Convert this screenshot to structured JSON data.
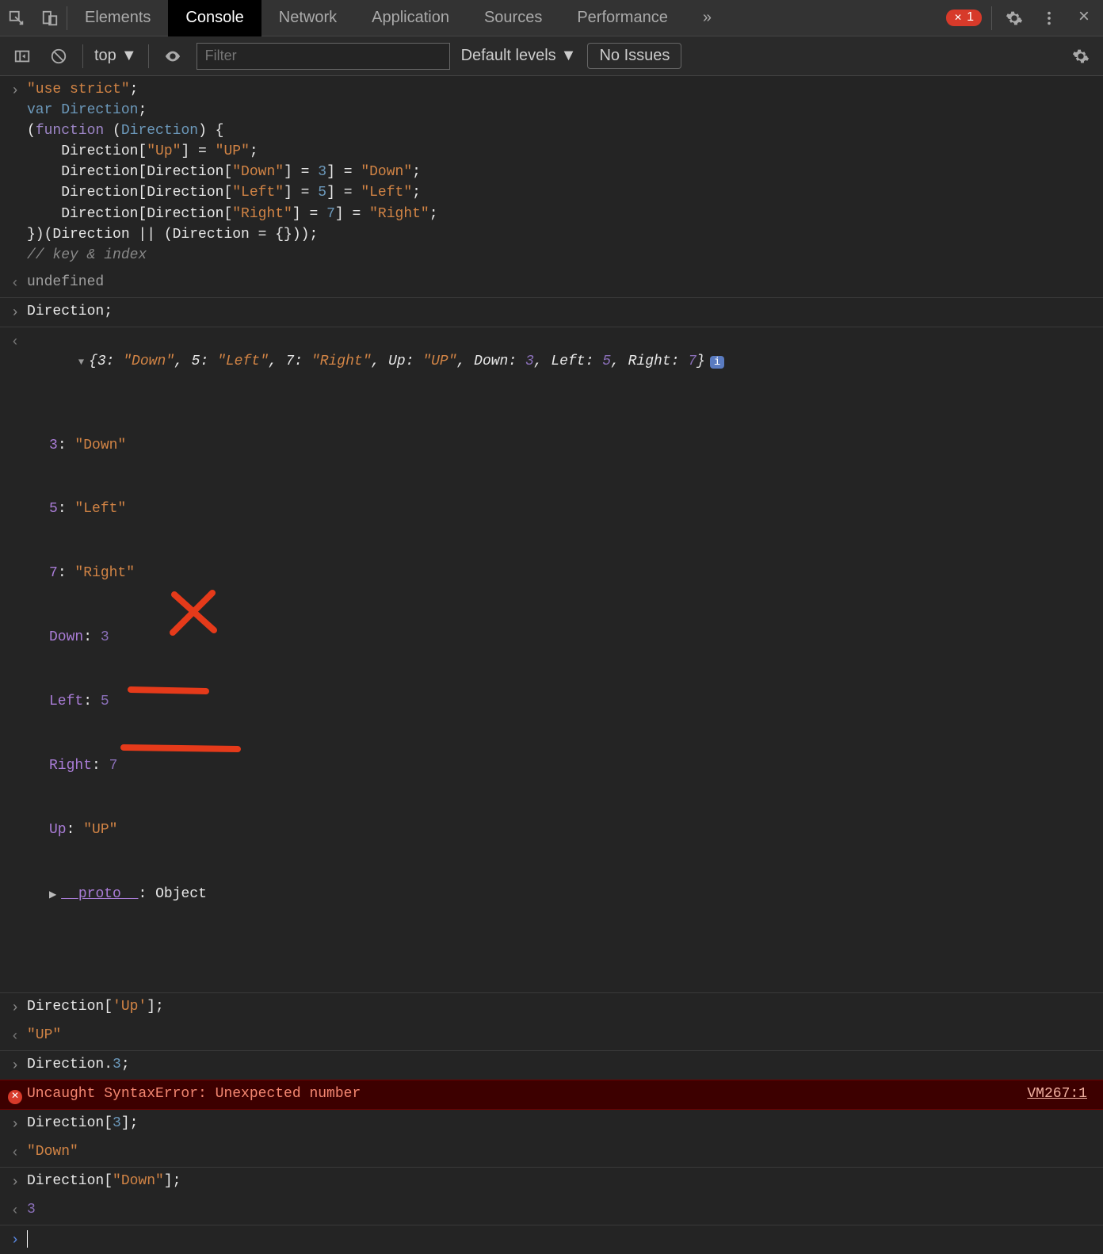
{
  "toolbar": {
    "tabs": [
      "Elements",
      "Console",
      "Network",
      "Application",
      "Sources",
      "Performance"
    ],
    "active_tab": "Console",
    "more": "»",
    "error_count": "1"
  },
  "subtoolbar": {
    "context": "top",
    "filter_placeholder": "Filter",
    "levels": "Default levels",
    "issues": "No Issues"
  },
  "console": {
    "block1": {
      "l1": "\"use strict\"",
      "l2_var": "var",
      "l2_name": "Direction",
      "l3a": "(",
      "l3_fn": "function",
      "l3b": " (",
      "l3_param": "Direction",
      "l3c": ") {",
      "l4a": "    Direction[",
      "l4b": "\"Up\"",
      "l4c": "] = ",
      "l4d": "\"UP\"",
      "l4e": ";",
      "l5a": "    Direction[Direction[",
      "l5b": "\"Down\"",
      "l5c": "] = ",
      "l5d": "3",
      "l5e": "] = ",
      "l5f": "\"Down\"",
      "l5g": ";",
      "l6a": "    Direction[Direction[",
      "l6b": "\"Left\"",
      "l6c": "] = ",
      "l6d": "5",
      "l6e": "] = ",
      "l6f": "\"Left\"",
      "l6g": ";",
      "l7a": "    Direction[Direction[",
      "l7b": "\"Right\"",
      "l7c": "] = ",
      "l7d": "7",
      "l7e": "] = ",
      "l7f": "\"Right\"",
      "l7g": ";",
      "l8": "})(Direction || (Direction = {}));",
      "comment": "// key & index"
    },
    "ret1": "undefined",
    "in2": "Direction;",
    "preview": {
      "p1": "{3: ",
      "p2": "\"Down\"",
      "p3": ", 5: ",
      "p4": "\"Left\"",
      "p5": ", 7: ",
      "p6": "\"Right\"",
      "p7": ", Up: ",
      "p8": "\"UP\"",
      "p9": ", Down: ",
      "p10": "3",
      "p11": ", Left: ",
      "p12": "5",
      "p13": ", Right: ",
      "p14": "7",
      "p15": "}",
      "info": "i"
    },
    "expanded": {
      "k1": "3",
      "v1": "\"Down\"",
      "k2": "5",
      "v2": "\"Left\"",
      "k3": "7",
      "v3": "\"Right\"",
      "k4": "Down",
      "v4": "3",
      "k5": "Left",
      "v5": "5",
      "k6": "Right",
      "v6": "7",
      "k7": "Up",
      "v7": "\"UP\"",
      "proto_k": "__proto__",
      "proto_v": "Object"
    },
    "in3a": "Direction[",
    "in3b": "'Up'",
    "in3c": "];",
    "ret3": "\"UP\"",
    "in4a": "Direction.",
    "in4b": "3",
    "in4c": ";",
    "err": {
      "msg": "Uncaught SyntaxError: Unexpected number",
      "src": "VM267:1"
    },
    "in5a": "Direction[",
    "in5b": "3",
    "in5c": "];",
    "ret5": "\"Down\"",
    "in6a": "Direction[",
    "in6b": "\"Down\"",
    "in6c": "];",
    "ret6": "3"
  }
}
